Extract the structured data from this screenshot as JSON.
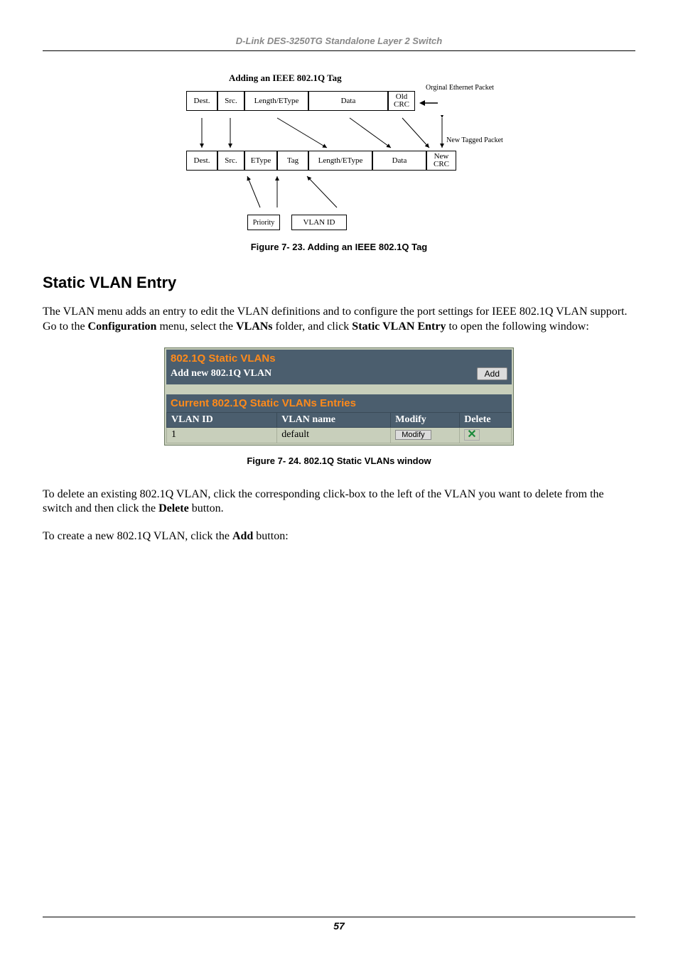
{
  "header": {
    "title": "D-Link DES-3250TG Standalone Layer 2 Switch"
  },
  "diagram": {
    "title": "Adding an IEEE 802.1Q Tag",
    "original_label": "Orginal Ethernet Packet",
    "new_tagged_label": "New Tagged Packet",
    "row1": {
      "dest": "Dest.",
      "src": "Src.",
      "len": "Length/EType",
      "data": "Data",
      "crc": "Old CRC"
    },
    "row2": {
      "dest": "Dest.",
      "src": "Src.",
      "etype": "EType",
      "tag": "Tag",
      "len": "Length/EType",
      "data": "Data",
      "crc": "New CRC"
    },
    "sub": {
      "priority": "Priority",
      "vlanid": "VLAN ID"
    }
  },
  "caption1": "Figure 7- 23.  Adding an IEEE 802.1Q Tag",
  "section_title": "Static VLAN Entry",
  "para1_a": "The VLAN menu adds an entry to edit the VLAN definitions and to configure the port settings for IEEE 802.1Q VLAN support. Go to the ",
  "para1_b": "Configuration",
  "para1_c": " menu, select the ",
  "para1_d": "VLANs",
  "para1_e": " folder, and click ",
  "para1_f": "Static VLAN Entry",
  "para1_g": " to open the following window:",
  "panel": {
    "heading1": "802.1Q Static VLANs",
    "add_label": "Add new 802.1Q VLAN",
    "add_btn": "Add",
    "heading2": "Current 802.1Q Static VLANs Entries",
    "cols": {
      "id": "VLAN ID",
      "name": "VLAN name",
      "modify": "Modify",
      "delete": "Delete"
    },
    "rows": [
      {
        "id": "1",
        "name": "default",
        "modify": "Modify"
      }
    ]
  },
  "caption2": "Figure 7- 24.  802.1Q Static VLANs window",
  "para2_a": "To delete an existing 802.1Q VLAN, click the corresponding click-box to the left of the VLAN you want to delete from the switch and then click the ",
  "para2_b": "Delete",
  "para2_c": " button.",
  "para3_a": "To create a new 802.1Q VLAN, click the ",
  "para3_b": "Add",
  "para3_c": " button:",
  "footer": {
    "page": "57"
  }
}
